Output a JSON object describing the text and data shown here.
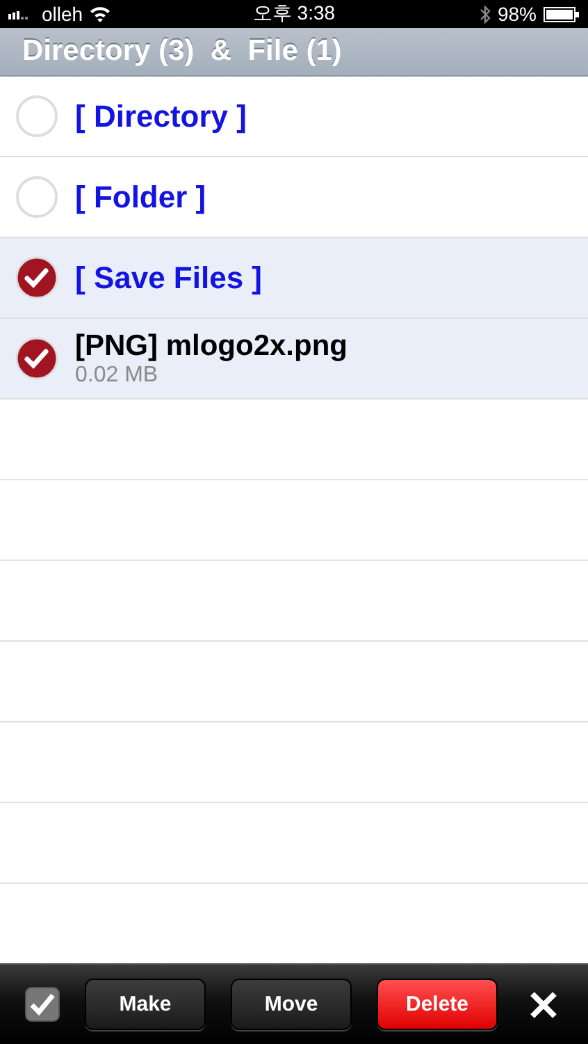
{
  "status_bar": {
    "carrier": "olleh",
    "time": "오후 3:38",
    "battery": "98%"
  },
  "header": {
    "title": "Directory (3)  &  File (1)"
  },
  "items": [
    {
      "kind": "directory",
      "name": "[ Directory ]",
      "selected": false
    },
    {
      "kind": "directory",
      "name": "[ Folder ]",
      "selected": false
    },
    {
      "kind": "directory",
      "name": "[ Save Files ]",
      "selected": true
    },
    {
      "kind": "file",
      "name": "[PNG] mlogo2x.png",
      "size": "0.02 MB",
      "selected": true
    }
  ],
  "toolbar": {
    "buttons": [
      {
        "label": "Make",
        "kind": "default"
      },
      {
        "label": "Move",
        "kind": "default"
      },
      {
        "label": "Delete",
        "kind": "destructive"
      }
    ]
  }
}
